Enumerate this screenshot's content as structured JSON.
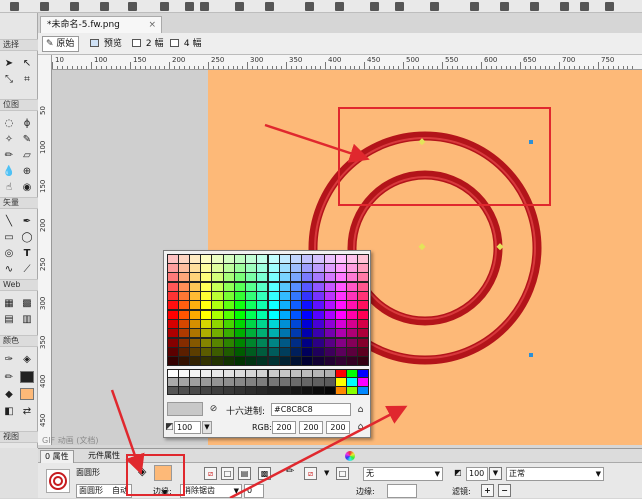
{
  "document": {
    "tab_title": "*未命名-5.fw.png",
    "close_glyph": "×"
  },
  "view_modes": [
    {
      "label": "原始",
      "active": true
    },
    {
      "label": "预览",
      "active": false
    },
    {
      "label": "2 幅",
      "active": false
    },
    {
      "label": "4 幅",
      "active": false
    }
  ],
  "tools_panel": {
    "sections": [
      "选择",
      "位图",
      "矢量",
      "Web",
      "颜色",
      "视图"
    ],
    "text_tool_glyph": "T"
  },
  "ruler": {
    "h_ticks": [
      "10",
      "100",
      "150",
      "200",
      "250",
      "300",
      "350",
      "400",
      "450",
      "500",
      "550",
      "600",
      "650",
      "700",
      "750"
    ],
    "v_ticks": [
      "50",
      "100",
      "150",
      "200",
      "250",
      "300",
      "350",
      "400",
      "450"
    ]
  },
  "canvas": {
    "background_color": "#fdb978",
    "ring_color": "#c61b1f"
  },
  "color_picker": {
    "hex_label": "十六进制:",
    "hex_value": "#C8C8C8",
    "rgb_label": "RGB:",
    "r": "200",
    "g": "200",
    "b": "200",
    "opacity": "100",
    "preview_color": "#c8c8c8"
  },
  "status": {
    "gif_caption": "GIF 动画 (文档)"
  },
  "properties": {
    "tabs": [
      {
        "label": "0 属性",
        "active": true
      },
      {
        "label": "元件属性",
        "active": false
      }
    ],
    "object_name": "面圆形",
    "object_type": "面圆形",
    "auto_label": "自动",
    "fill_color": "#fdb978",
    "stroke_type": "无",
    "edge_label": "边缘:",
    "edge_value": "消除锯齿",
    "edge_num": "0",
    "opacity": "100",
    "blend_mode": "正常",
    "filters_label": "滤镜:",
    "stroke_edge_label": "边缘:",
    "add_glyph": "+",
    "remove_glyph": "−"
  },
  "annotations": {
    "arrow_color": "#e0282e",
    "box_color": "#e0282e"
  }
}
